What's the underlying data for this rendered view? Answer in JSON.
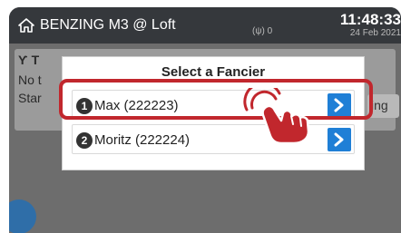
{
  "topbar": {
    "title": "BENZING M3 @ Loft",
    "signal": "(ψ) 0",
    "time": "11:48:33",
    "date": "24 Feb 2021"
  },
  "background": {
    "line1": "Ƴ T",
    "line2": "No t",
    "line3": "Star",
    "side_button": "ing"
  },
  "modal": {
    "title": "Select a Fancier",
    "items": [
      {
        "number": "1",
        "label": "Max (222223)"
      },
      {
        "number": "2",
        "label": "Moritz (222224)"
      }
    ]
  },
  "colors": {
    "accent": "#1f7fd6",
    "highlight": "#c1272d",
    "topbar": "#35383c"
  },
  "icons": [
    "home-icon",
    "chevron-right-icon",
    "tap-hand-icon"
  ]
}
